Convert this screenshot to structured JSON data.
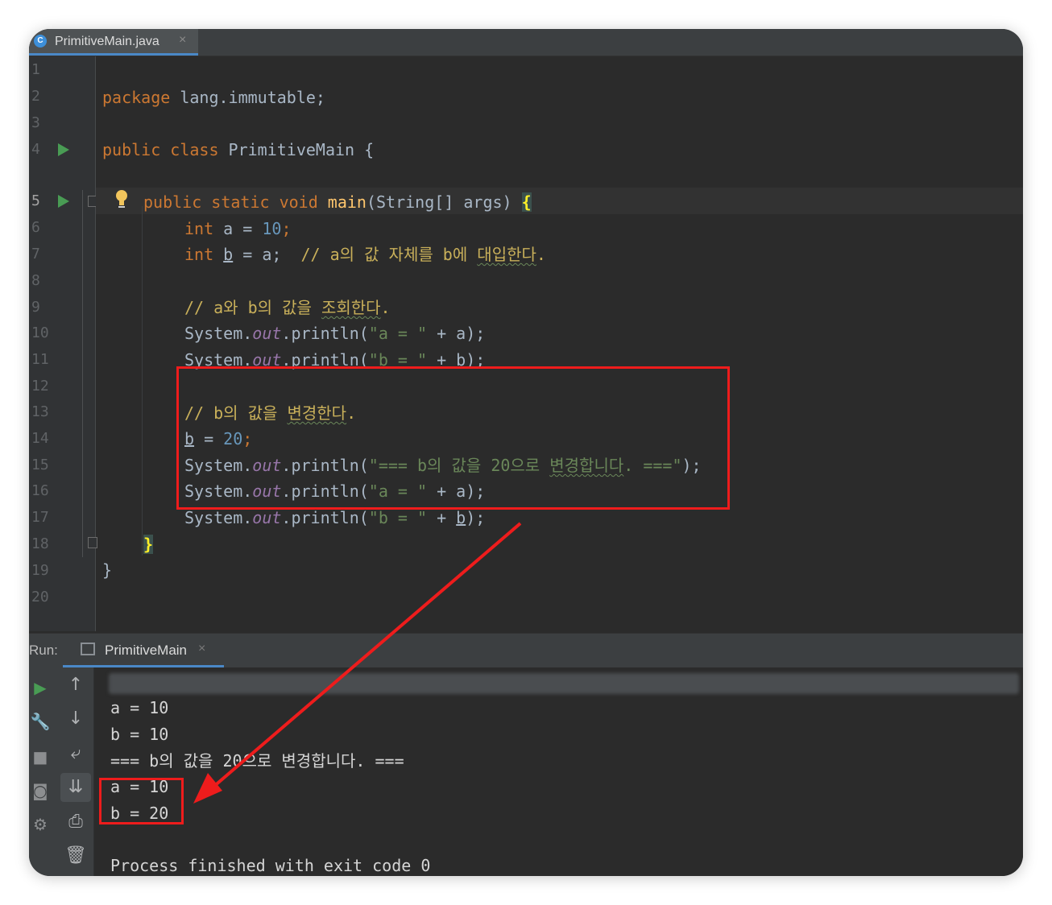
{
  "editor_tab": {
    "filename": "PrimitiveMain.java",
    "icon": "java-class-icon",
    "close": "×"
  },
  "line_numbers": [
    "1",
    "2",
    "3",
    "4",
    "5",
    "6",
    "7",
    "8",
    "9",
    "10",
    "11",
    "12",
    "13",
    "14",
    "15",
    "16",
    "17",
    "18",
    "19",
    "20"
  ],
  "code": {
    "l1_kw": "package",
    "l1_rest": " lang.immutable;",
    "l3_kw": "public class",
    "l3_rest": " PrimitiveMain {",
    "l5_kw": "public static void",
    "l5_fn": "main",
    "l5_params": "(String[] args) ",
    "l5_brace": "{",
    "l6_kw": "int",
    "l6_var": " a = ",
    "l6_num": "10",
    "l6_end": ";",
    "l7_kw": "int",
    "l7_sp": " ",
    "l7_var": "b",
    "l7_mid": " = a;  ",
    "l7_cmt1": "// a의 값 자체를 b에 ",
    "l7_cmt2": "대입한다",
    "l7_cmt3": ".",
    "l9_cmt1": "// a와 b의 값을 ",
    "l9_cmt2": "조회한다",
    "l9_cmt3": ".",
    "l10_sys": "System.",
    "l10_out": "out",
    "l10_call": ".println(",
    "l10_str": "\"a = \"",
    "l10_end": " + a);",
    "l11_sys": "System.",
    "l11_out": "out",
    "l11_call": ".println(",
    "l11_str": "\"b = \"",
    "l11_plus": " + ",
    "l11_var": "b",
    "l11_end": ");",
    "l13_cmt1": "// b의 값을 ",
    "l13_cmt2": "변경한다",
    "l13_cmt3": ".",
    "l14_var": "b",
    "l14_mid": " = ",
    "l14_num": "20",
    "l14_end": ";",
    "l15_sys": "System.",
    "l15_out": "out",
    "l15_call": ".println(",
    "l15_str1": "\"=== b의 값을 20으로 ",
    "l15_str2": "변경합니다",
    "l15_str3": ". ===\"",
    "l15_end": ");",
    "l16_sys": "System.",
    "l16_out": "out",
    "l16_call": ".println(",
    "l16_str": "\"a = \"",
    "l16_end": " + a);",
    "l17_sys": "System.",
    "l17_out": "out",
    "l17_call": ".println(",
    "l17_str": "\"b = \"",
    "l17_plus": " + ",
    "l17_var": "b",
    "l17_end": ");",
    "l18_brace": "}",
    "l19_brace": "}"
  },
  "run_panel": {
    "label": "Run:",
    "tab_name": "PrimitiveMain",
    "close": "×",
    "output": [
      "a = 10",
      "b = 10",
      "=== b의 값을 20으로 변경합니다. ===",
      "a = 10",
      "b = 20",
      "",
      "Process finished with exit code 0"
    ]
  },
  "colors": {
    "annotation": "#ee1c1c",
    "keyword": "#cc7832",
    "number": "#6897bb",
    "string": "#6a8759",
    "comment": "#c9b05a"
  }
}
